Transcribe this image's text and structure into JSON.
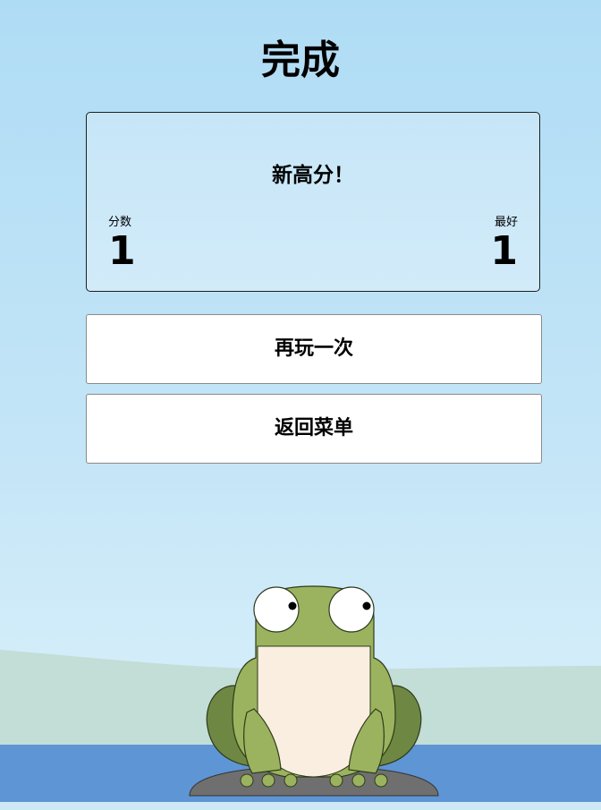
{
  "screen": {
    "title": "完成"
  },
  "result": {
    "headline": "新高分！",
    "score_label": "分数",
    "score_value": "1",
    "best_label": "最好",
    "best_value": "1"
  },
  "buttons": {
    "play_again": "再玩一次",
    "back_to_menu": "返回菜单"
  },
  "colors": {
    "sky_top": "#afdcf5",
    "sky_bottom": "#d6eef9",
    "hill": "#c3ddd7",
    "water": "#5e95d4",
    "lily_pad": "#6f6f6f",
    "frog_green": "#9bb35e",
    "frog_dark_green": "#6e8742",
    "frog_belly": "#f9eedf"
  }
}
